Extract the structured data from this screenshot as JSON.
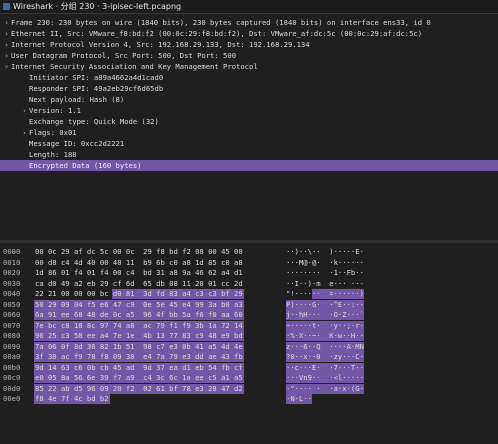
{
  "window": {
    "title": "Wireshark · 分组 230 · 3-ipisec-left.pcapng"
  },
  "colors": {
    "selection": "#7157a6",
    "background": "#1f1f1f",
    "text": "#dcdcdc"
  },
  "tree": [
    {
      "text": "Frame 230: 230 bytes on wire (1840 bits), 230 bytes captured (1840 bits) on interface ens33, id 0",
      "indent": 0,
      "expander": "collapsed",
      "selected": false
    },
    {
      "text": "Ethernet II, Src: VMware_f8:bd:f2 (00:0c:29:f8:bd:f2), Dst: VMware_af:dc:5c (00:0c:29:af:dc:5c)",
      "indent": 0,
      "expander": "collapsed",
      "selected": false
    },
    {
      "text": "Internet Protocol Version 4, Src: 192.168.29.133, Dst: 192.168.29.134",
      "indent": 0,
      "expander": "collapsed",
      "selected": false
    },
    {
      "text": "User Datagram Protocol, Src Port: 500, Dst Port: 500",
      "indent": 0,
      "expander": "collapsed",
      "selected": false
    },
    {
      "text": "Internet Security Association and Key Management Protocol",
      "indent": 0,
      "expander": "expanded",
      "selected": false
    },
    {
      "text": "Initiator SPI: a89a4662a4d1cad0",
      "indent": 1,
      "expander": "none",
      "selected": false
    },
    {
      "text": "Responder SPI: 49a2eb29cf6d65db",
      "indent": 1,
      "expander": "none",
      "selected": false
    },
    {
      "text": "Next payload: Hash (8)",
      "indent": 1,
      "expander": "none",
      "selected": false
    },
    {
      "text": "Version: 1.1",
      "indent": 1,
      "expander": "collapsed",
      "selected": false
    },
    {
      "text": "Exchange type: Quick Mode (32)",
      "indent": 1,
      "expander": "none",
      "selected": false
    },
    {
      "text": "Flags: 0x01",
      "indent": 1,
      "expander": "collapsed",
      "selected": false
    },
    {
      "text": "Message ID: 0xcc2d2221",
      "indent": 1,
      "expander": "none",
      "selected": false
    },
    {
      "text": "Length: 188",
      "indent": 1,
      "expander": "none",
      "selected": false
    },
    {
      "text": "Encrypted Data (160 bytes)",
      "indent": 1,
      "expander": "none",
      "selected": true
    }
  ],
  "bytes": [
    {
      "offset": "0000",
      "hex": "00 0c 29 af dc 5c 00 0c  29 f8 bd f2 08 00 45 00",
      "ascii": "··)··\\··  )·····E·",
      "hl_start": -1
    },
    {
      "offset": "0010",
      "hex": "00 d8 c4 4d 40 00 40 11  b9 6b c0 a8 1d 85 c0 a8",
      "ascii": "···M@·@·  ·k······",
      "hl_start": -1
    },
    {
      "offset": "0020",
      "hex": "1d 86 01 f4 01 f4 00 c4  bd 31 a8 9a 46 62 a4 d1",
      "ascii": "········  ·1··Fb··",
      "hl_start": -1
    },
    {
      "offset": "0030",
      "hex": "ca d0 49 a2 eb 29 cf 6d  65 db 08 11 20 01 cc 2d",
      "ascii": "··I··)·m  e··· ··-",
      "hl_start": -1
    },
    {
      "offset": "0040",
      "hex": "22 21 00 00 00 bc d0 81  3d fd 83 a4 c3 c3 bf 29",
      "ascii": "\"!······  =······)",
      "hl_start": 6
    },
    {
      "offset": "0050",
      "hex": "50 29 09 04 f5 e6 47 c9  0e 5e 45 e4 99 3a b0 a3",
      "ascii": "P)····G·  ·^E··:··",
      "hl_start": 0
    },
    {
      "offset": "0060",
      "hex": "6a 91 ee 68 48 de 0c a5  96 4f bb 5a f6 f0 aa 60",
      "ascii": "j··hH···  ·O·Z···`",
      "hl_start": 0
    },
    {
      "offset": "0070",
      "hex": "7e bc c8 18 8c 97 74 a8  ac 79 f1 f9 3b 1a 72 14",
      "ascii": "~·····t·  ·y··;·r·",
      "hl_start": 0
    },
    {
      "offset": "0080",
      "hex": "96 25 c3 58 ee a4 7e 1e  4b 13 77 83 c9 48 e9 bd",
      "ascii": "·%·X··~·  K·w··H··",
      "hl_start": 0
    },
    {
      "offset": "0090",
      "hex": "7a 06 0f 8d 36 82 1b 51  98 c7 e3 0b 41 a5 4d 4e",
      "ascii": "z···6··Q  ····A·MN",
      "hl_start": 0
    },
    {
      "offset": "00a0",
      "hex": "3f 30 ac f9 78 f8 09 30  e4 7a 79 e3 dd ae 43 fb",
      "ascii": "?0··x··0  ·zy···C·",
      "hl_start": 0
    },
    {
      "offset": "00b0",
      "hex": "9d 14 63 c6 0b cb 45 ad  9d 37 ea d1 eb 54 fb cf",
      "ascii": "··c···E·  ·7···T··",
      "hl_start": 0
    },
    {
      "offset": "00c0",
      "hex": "e0 05 8a 56 6e 39 f7 a9  c4 3c 6c 1a ee c5 a1 a5",
      "ascii": "···Vn9··  ·<l·····",
      "hl_start": 0
    },
    {
      "offset": "00d0",
      "hex": "85 22 ab d5 96 09 20 f2  02 61 bf 78 e3 28 47 d2",
      "ascii": "·\"···· ·  ·a·x·(G·",
      "hl_start": 0
    },
    {
      "offset": "00e0",
      "hex": "f8 4e 7f 4c bd b2",
      "ascii": "·N·L··",
      "hl_start": 0
    }
  ]
}
